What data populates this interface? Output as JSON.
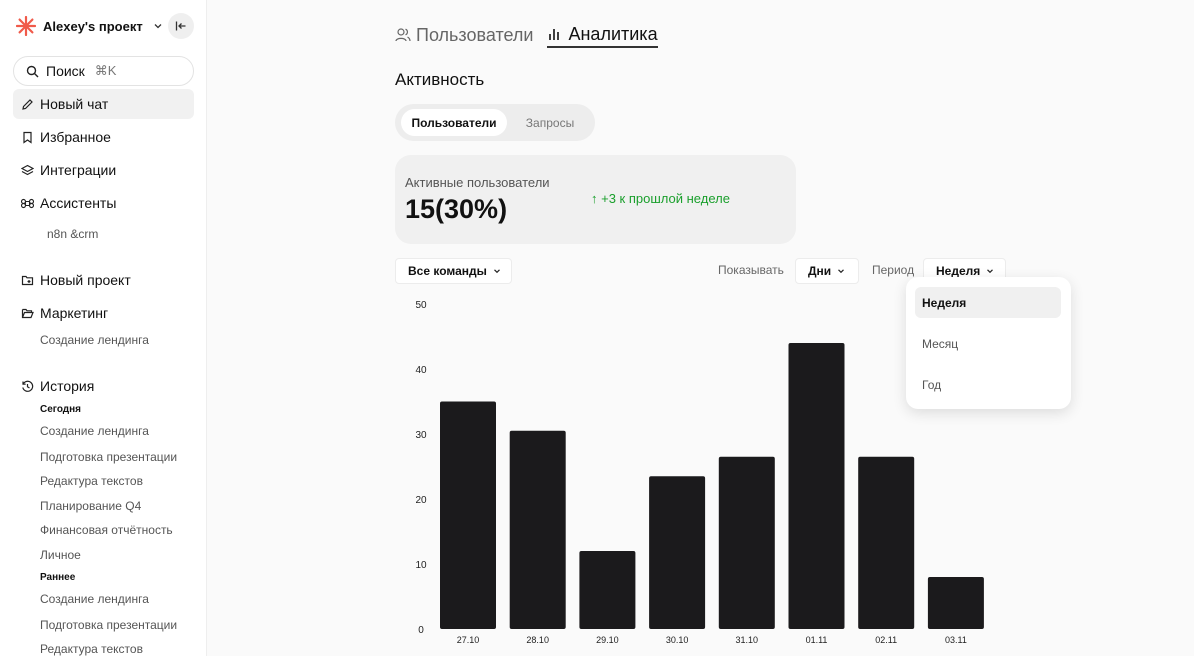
{
  "sidebar": {
    "project_name": "Alexey's проект",
    "search_label": "Поиск",
    "search_shortcut": "⌘K",
    "nav": {
      "new_chat": "Новый чат",
      "favorites": "Избранное",
      "integrations": "Интеграции",
      "assistants": "Ассистенты",
      "assistant_sub": "n8n &crm",
      "new_project": "Новый проект",
      "marketing": "Маркетинг",
      "marketing_sub": "Создание лендинга",
      "history": "История"
    },
    "history": {
      "today_label": "Сегодня",
      "today": [
        "Создание лендинга",
        "Подготовка презентации",
        "Редактура текстов",
        "Планирование Q4",
        "Финансовая отчётность",
        "Личное"
      ],
      "earlier_label": "Раннее",
      "earlier": [
        "Создание лендинга",
        "Подготовка презентации",
        "Редактура текстов"
      ]
    }
  },
  "tabs": {
    "users": "Пользователи",
    "analytics": "Аналитика"
  },
  "section_title": "Активность",
  "segment": {
    "users": "Пользователи",
    "requests": "Запросы"
  },
  "stat_card": {
    "label": "Активные пользователи",
    "value": "15(30%)",
    "delta": "↑ +3 к прошлой неделе"
  },
  "controls": {
    "teams": "Все команды",
    "show_label": "Показывать",
    "show_value": "Дни",
    "period_label": "Период",
    "period_value": "Неделя"
  },
  "period_menu": [
    "Неделя",
    "Месяц",
    "Год"
  ],
  "colors": {
    "bar": "#1b1a1c",
    "positive": "#1a9f2c"
  },
  "chart_data": {
    "type": "bar",
    "categories": [
      "27.10",
      "28.10",
      "29.10",
      "30.10",
      "31.10",
      "01.11",
      "02.11",
      "03.11"
    ],
    "values": [
      35,
      30.5,
      12,
      23.5,
      26.5,
      44,
      26.5,
      8
    ],
    "ylim": [
      0,
      50
    ],
    "yticks": [
      0,
      10,
      20,
      30,
      40,
      50
    ],
    "grid": false
  }
}
